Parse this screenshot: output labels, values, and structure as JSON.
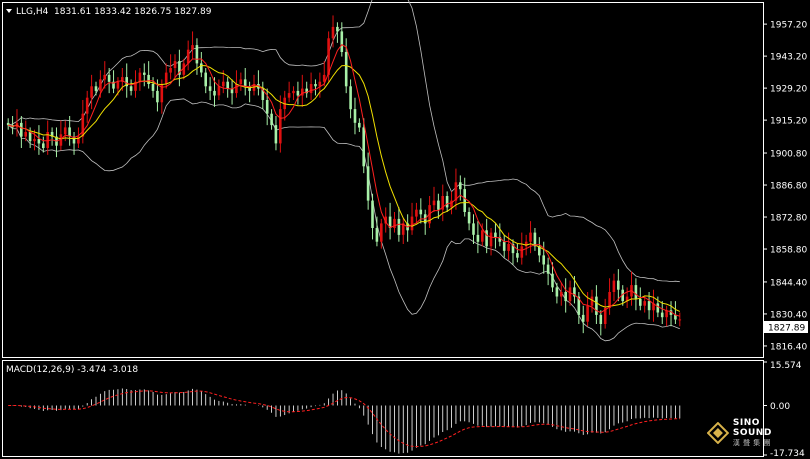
{
  "header": {
    "symbol": "LLG,H4",
    "ohlc": "1831.61 1833.42 1826.75 1827.89"
  },
  "macd_header": {
    "label": "MACD(12,26,9) -3.474 -3.018"
  },
  "watermark": {
    "brand": "SINO SOUND",
    "sub": "漢 聲 集 團"
  },
  "colors": {
    "background": "#000000",
    "bull": "#e01010",
    "bear": "#a8f0a8",
    "ma_fast": "#ff2020",
    "ma_slow": "#f0e000",
    "band": "#c0c0c0",
    "macd_hist": "#ffffff",
    "macd_signal": "#ff2020",
    "price_box": "#ffffff"
  },
  "chart_data": [
    {
      "type": "candlestick",
      "title": "LLG,H4",
      "ohlc_last": {
        "open": 1831.61,
        "high": 1833.42,
        "low": 1826.75,
        "close": 1827.89
      },
      "ylim": [
        1812,
        1966
      ],
      "yticks": [
        1957.2,
        1943.2,
        1929.2,
        1915.2,
        1900.8,
        1886.8,
        1872.8,
        1858.8,
        1844.4,
        1830.4,
        1816.4
      ],
      "ytick_labels": [
        "1957.20",
        "1943.20",
        "1929.20",
        "1915.20",
        "1900.80",
        "1886.80",
        "1872.80",
        "1858.80",
        "1844.40",
        "1830.40",
        "1816.40"
      ],
      "current_price_label": "1827.89",
      "closes": [
        1913,
        1912,
        1914,
        1908,
        1910,
        1906,
        1907,
        1905,
        1903,
        1910,
        1908,
        1904,
        1909,
        1912,
        1908,
        1905,
        1908,
        1918,
        1925,
        1930,
        1928,
        1933,
        1935,
        1932,
        1929,
        1932,
        1934,
        1930,
        1928,
        1932,
        1936,
        1935,
        1931,
        1928,
        1923,
        1931,
        1936,
        1938,
        1941,
        1935,
        1940,
        1946,
        1948,
        1940,
        1936,
        1930,
        1928,
        1926,
        1930,
        1932,
        1929,
        1927,
        1931,
        1933,
        1930,
        1928,
        1931,
        1929,
        1924,
        1918,
        1913,
        1905,
        1920,
        1925,
        1927,
        1928,
        1926,
        1929,
        1927,
        1931,
        1930,
        1932,
        1935,
        1951,
        1956,
        1954,
        1945,
        1930,
        1920,
        1914,
        1912,
        1895,
        1880,
        1868,
        1862,
        1870,
        1873,
        1868,
        1872,
        1865,
        1870,
        1867,
        1873,
        1876,
        1874,
        1870,
        1878,
        1880,
        1876,
        1882,
        1877,
        1880,
        1888,
        1885,
        1875,
        1870,
        1865,
        1862,
        1867,
        1860,
        1866,
        1864,
        1862,
        1858,
        1861,
        1857,
        1855,
        1860,
        1862,
        1866,
        1860,
        1856,
        1852,
        1848,
        1842,
        1838,
        1840,
        1836,
        1842,
        1838,
        1830,
        1827,
        1834,
        1838,
        1830,
        1826,
        1833,
        1840,
        1845,
        1841,
        1836,
        1838,
        1843,
        1837,
        1834,
        1836,
        1832,
        1835,
        1831,
        1829,
        1832,
        1830,
        1828,
        1828
      ],
      "indicators": [
        "moving_average_fast",
        "moving_average_slow",
        "bollinger_bands"
      ]
    },
    {
      "type": "bar",
      "title": "MACD(12,26,9)",
      "macd": -3.474,
      "signal": -3.018,
      "ylim": [
        -17.734,
        15.574
      ],
      "yticks": [
        15.574,
        0.0,
        -17.734
      ],
      "ytick_labels": [
        "15.574",
        "0.00",
        "-17.734"
      ]
    }
  ]
}
